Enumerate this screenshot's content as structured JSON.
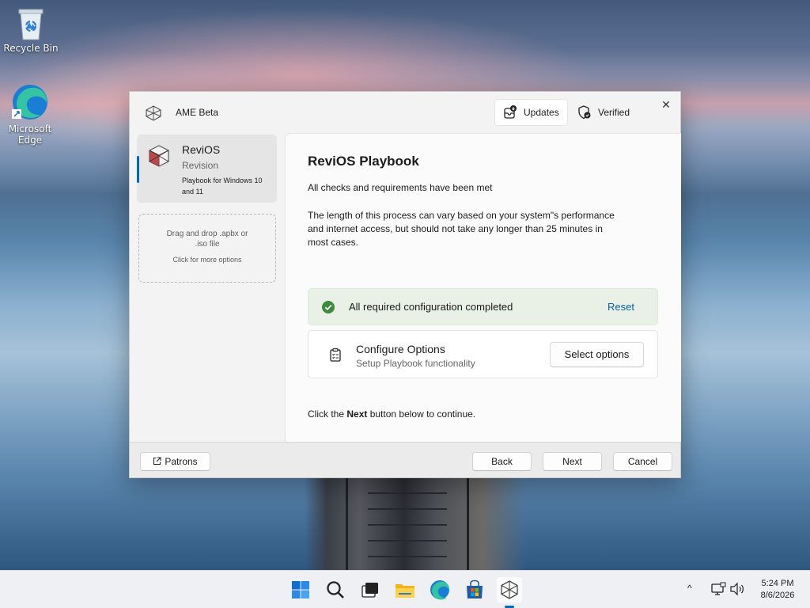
{
  "desktop": {
    "icons": [
      {
        "label": "Recycle Bin"
      },
      {
        "label": "Microsoft Edge"
      }
    ]
  },
  "window": {
    "title": "AME Beta",
    "header_buttons": {
      "updates": "Updates",
      "verified": "Verified"
    },
    "close_glyph": "✕"
  },
  "sidebar": {
    "playbook": {
      "name": "ReviOS",
      "author": "Revision",
      "description": "Playbook for Windows 10 and 11"
    },
    "dropzone": {
      "text": "Drag and drop .apbx or .iso file",
      "more": "Click for more options"
    }
  },
  "content": {
    "title": "ReviOS Playbook",
    "requirements": "All checks and requirements have been met",
    "description": "The length of this process can vary based on your system\"s performance and internet access, but should not take any longer than 25 minutes in most cases.",
    "status": {
      "text": "All required configuration completed",
      "action": "Reset",
      "color": "#3e8a3f"
    },
    "configure": {
      "title": "Configure Options",
      "subtitle": "Setup Playbook functionality",
      "button": "Select options"
    },
    "continue_prefix": "Click the ",
    "continue_bold": "Next",
    "continue_suffix": " button below to continue."
  },
  "footer": {
    "patrons": "Patrons",
    "back": "Back",
    "next": "Next",
    "cancel": "Cancel"
  },
  "taskbar": {
    "icons": [
      "start-icon",
      "search-icon",
      "task-view-icon",
      "file-explorer-icon",
      "edge-icon",
      "store-icon",
      "ame-wizard-icon"
    ],
    "tray_chevron": "^",
    "time": "5:24 PM",
    "date": "8/6/2026"
  },
  "colors": {
    "accent": "#0067c0",
    "link": "#0a5fab"
  }
}
